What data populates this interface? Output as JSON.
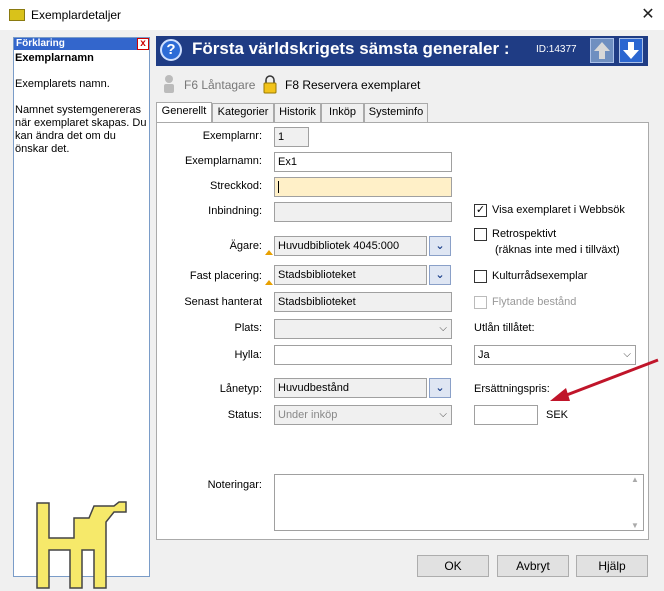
{
  "window": {
    "title": "Exemplardetaljer",
    "close_icon": "close-icon"
  },
  "help": {
    "header": "Förklaring",
    "title": "Exemplarnamn",
    "paragraph1": "Exemplarets namn.",
    "paragraph2": "Namnet systemgenereras när exemplaret skapas. Du kan ändra det om du önskar det."
  },
  "header": {
    "help_glyph": "?",
    "title": "Första världskrigets sämsta generaler :",
    "id": "ID:14377"
  },
  "actions": {
    "borrower": "F6 Låntagare",
    "reserve": "F8 Reservera exemplaret"
  },
  "tabs": [
    "Generellt",
    "Kategorier",
    "Historik",
    "Inköp",
    "Systeminfo"
  ],
  "form": {
    "exemplarnr_label": "Exemplarnr:",
    "exemplarnr": "1",
    "exemplarnamn_label": "Exemplarnamn:",
    "exemplarnamn": "Ex1",
    "streckkod_label": "Streckkod:",
    "streckkod": "",
    "inbindning_label": "Inbindning:",
    "inbindning": "",
    "agare_label": "Ägare:",
    "agare": "Huvudbibliotek 4045:000",
    "fast_placering_label": "Fast placering:",
    "fast_placering": "Stadsbiblioteket",
    "senast_hanterat_label": "Senast hanterat",
    "senast_hanterat": "Stadsbiblioteket",
    "plats_label": "Plats:",
    "plats": "",
    "hylla_label": "Hylla:",
    "hylla": "",
    "lanetyp_label": "Lånetyp:",
    "lanetyp": "Huvudbestånd",
    "status_label": "Status:",
    "status": "Under inköp",
    "noteringar_label": "Noteringar:",
    "noteringar": ""
  },
  "options": {
    "webbsok": "Visa exemplaret i Webbsök",
    "retro_line1": "Retrospektivt",
    "retro_line2": "(räknas inte med i tillväxt)",
    "kultur": "Kulturrådsexemplar",
    "flytande": "Flytande bestånd",
    "utlan_label": "Utlån tillåtet:",
    "utlan_value": "Ja",
    "ersattning_label": "Ersättningspris:",
    "ersattning_value": "",
    "currency": "SEK",
    "check_glyph": "✓"
  },
  "buttons": {
    "ok": "OK",
    "cancel": "Avbryt",
    "help": "Hjälp"
  },
  "colors": {
    "header_bg": "#1f3c84",
    "required_bg": "#fff0c8",
    "arrow": "#c0152a"
  }
}
